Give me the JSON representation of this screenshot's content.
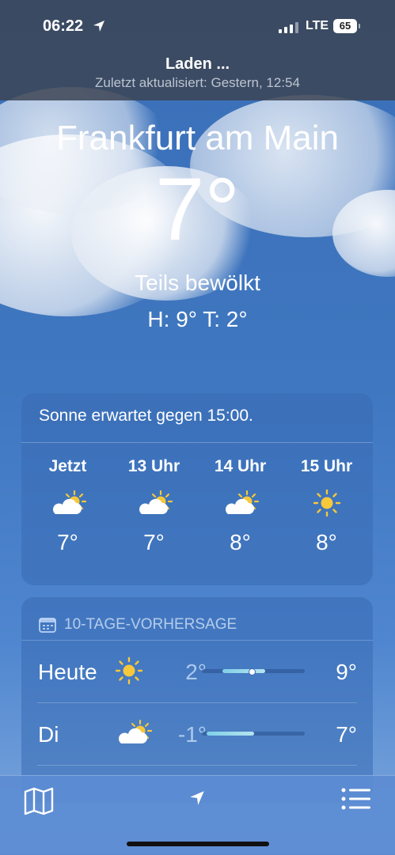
{
  "status": {
    "time": "06:22",
    "network": "LTE",
    "battery": "65"
  },
  "header": {
    "loading": "Laden ...",
    "updated": "Zuletzt aktualisiert: Gestern, 12:54"
  },
  "current": {
    "city": "Frankfurt am Main",
    "temp": "7°",
    "condition": "Teils bewölkt",
    "high_low": "H: 9°  T: 2°"
  },
  "hourly": {
    "summary": "Sonne erwartet gegen 15:00.",
    "items": [
      {
        "label": "Jetzt",
        "icon": "partly-cloudy-icon",
        "temp": "7°"
      },
      {
        "label": "13 Uhr",
        "icon": "partly-cloudy-icon",
        "temp": "7°"
      },
      {
        "label": "14 Uhr",
        "icon": "partly-cloudy-icon",
        "temp": "8°"
      },
      {
        "label": "15 Uhr",
        "icon": "sun-icon",
        "temp": "8°"
      }
    ]
  },
  "forecast": {
    "title": "10-TAGE-VORHERSAGE",
    "days": [
      {
        "day": "Heute",
        "icon": "sun-icon",
        "low": "2°",
        "high": "9°"
      },
      {
        "day": "Di",
        "icon": "partly-cloudy-icon",
        "low": "-1°",
        "high": "7°"
      }
    ]
  },
  "colors": {
    "sun": "#f6c83a",
    "background": "#3f77c0"
  }
}
